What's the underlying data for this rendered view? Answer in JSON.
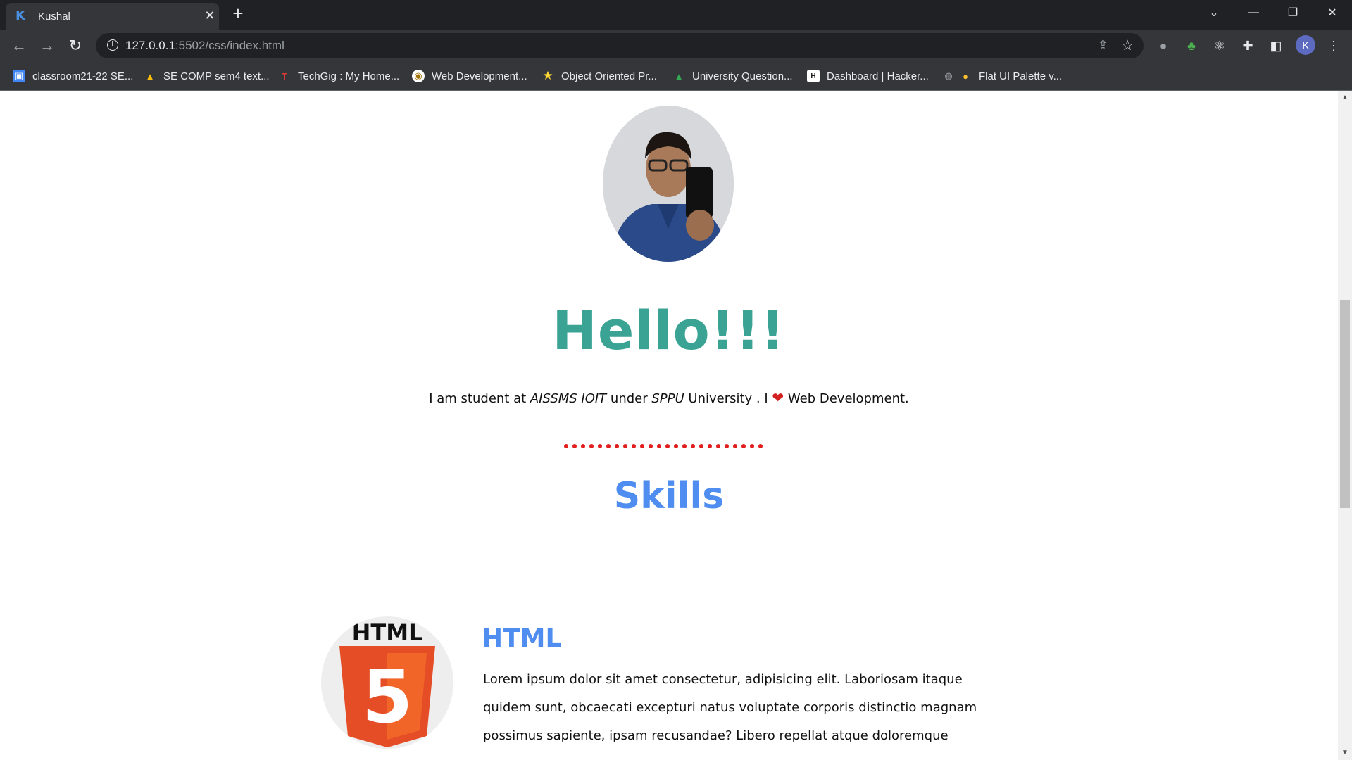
{
  "browser": {
    "tab": {
      "title": "Kushal",
      "favicon": "K",
      "close": "✕"
    },
    "new_tab": "+",
    "window_controls": {
      "tab_search": "⌄",
      "minimize": "—",
      "restore": "❐",
      "close": "✕"
    },
    "url": {
      "host": "127.0.0.1",
      "rest": ":5502/css/index.html"
    },
    "bookmarks": [
      {
        "label": "classroom21-22 SE...",
        "icon": "classroom-icon"
      },
      {
        "label": "SE COMP sem4 text...",
        "icon": "google-drive-icon"
      },
      {
        "label": "TechGig : My Home...",
        "icon": "techgig-icon"
      },
      {
        "label": "Web Development...",
        "icon": "badge-icon"
      },
      {
        "label": "Object Oriented Pr...",
        "icon": "star-icon"
      },
      {
        "label": "University Question...",
        "icon": "google-drive-icon"
      },
      {
        "label": "Dashboard | Hacker...",
        "icon": "hackerrank-icon"
      },
      {
        "label": "Flat UI Palette v...",
        "icon": "globe-palette-icon"
      }
    ],
    "avatar_initial": "K"
  },
  "page": {
    "heading": "Hello!!!",
    "intro": {
      "p1": "I am student at ",
      "college": "AISSMS IOIT",
      "p2": " under ",
      "university": "SPPU",
      "p3": " University . I ",
      "heart": "❤",
      "p4": " Web Development."
    },
    "skills_title": "Skills",
    "skills": [
      {
        "name": "HTML",
        "logo_text": "HTML",
        "logo_number": "5",
        "description": "Lorem ipsum dolor sit amet consectetur, adipisicing elit. Laboriosam itaque quidem sunt, obcaecati excepturi natus voluptate corporis distinctio magnam possimus sapiente, ipsam recusandae? Libero repellat atque doloremque"
      }
    ],
    "colors": {
      "heading": "#3aa394",
      "skills": "#4f8ef0",
      "dots": "#e01e1e",
      "html5_orange": "#e44d26"
    }
  }
}
